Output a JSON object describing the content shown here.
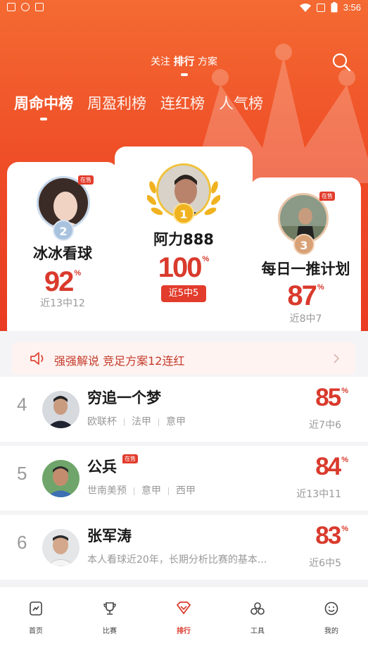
{
  "status_bar": {
    "time": "3:56",
    "battery": "8"
  },
  "header": {
    "title_prefix": "关注",
    "title_bold": "排行",
    "title_suffix": "方案"
  },
  "tabs": [
    {
      "label": "周命中榜",
      "active": true
    },
    {
      "label": "周盈利榜",
      "active": false
    },
    {
      "label": "连红榜",
      "active": false
    },
    {
      "label": "人气榜",
      "active": false
    }
  ],
  "podium": {
    "first": {
      "rank": "1",
      "name": "阿力888",
      "pct": "100",
      "unit": "%",
      "record": "近5中5"
    },
    "second": {
      "rank": "2",
      "name": "冰冰看球",
      "pct": "92",
      "unit": "%",
      "record": "近13中12",
      "badge": "在售"
    },
    "third": {
      "rank": "3",
      "name": "每日一推计划",
      "pct": "87",
      "unit": "%",
      "record": "近8中7",
      "badge": "在售"
    }
  },
  "notice": {
    "text": "强强解说 竞足方案12连红"
  },
  "list": [
    {
      "rank": "4",
      "name": "穷追一个梦",
      "tags": [
        "欧联杯",
        "法甲",
        "意甲"
      ],
      "pct": "85",
      "unit": "%",
      "record": "近7中6"
    },
    {
      "rank": "5",
      "name": "公兵",
      "badge": "在售",
      "tags": [
        "世南美预",
        "意甲",
        "西甲"
      ],
      "pct": "84",
      "unit": "%",
      "record": "近13中11"
    },
    {
      "rank": "6",
      "name": "张军涛",
      "desc": "本人看球近20年，长期分析比赛的基本...",
      "pct": "83",
      "unit": "%",
      "record": "近6中5"
    }
  ],
  "bottom_nav": [
    {
      "label": "首页",
      "icon": "chart-icon"
    },
    {
      "label": "比赛",
      "icon": "trophy-icon"
    },
    {
      "label": "排行",
      "icon": "rank-icon",
      "active": true
    },
    {
      "label": "工具",
      "icon": "tools-icon"
    },
    {
      "label": "我的",
      "icon": "smile-icon"
    }
  ],
  "colors": {
    "hero": "#ee4a26",
    "accent": "#d93a2c",
    "gold": "#f0b21f",
    "silver": "#a9c3df",
    "bronze": "#d8a176"
  }
}
